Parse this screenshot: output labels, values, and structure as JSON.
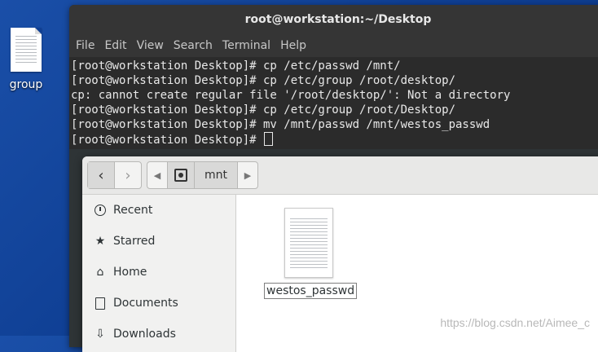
{
  "desktop": {
    "icon_label": "group",
    "icon": "text-file-icon"
  },
  "terminal": {
    "title": "root@workstation:~/Desktop",
    "menu": [
      "File",
      "Edit",
      "View",
      "Search",
      "Terminal",
      "Help"
    ],
    "lines": [
      "[root@workstation Desktop]# cp /etc/passwd /mnt/",
      "[root@workstation Desktop]# cp /etc/group /root/desktop/",
      "cp: cannot create regular file '/root/desktop/': Not a directory",
      "[root@workstation Desktop]# cp /etc/group /root/Desktop/",
      "[root@workstation Desktop]# mv /mnt/passwd /mnt/westos_passwd",
      "[root@workstation Desktop]# "
    ]
  },
  "files": {
    "nav": {
      "back": "‹",
      "forward": "›"
    },
    "path": {
      "current": "mnt"
    },
    "sidebar": [
      {
        "label": "Recent",
        "icon": "clock-icon"
      },
      {
        "label": "Starred",
        "icon": "star-icon"
      },
      {
        "label": "Home",
        "icon": "home-icon"
      },
      {
        "label": "Documents",
        "icon": "document-icon"
      },
      {
        "label": "Downloads",
        "icon": "download-icon"
      }
    ],
    "items": [
      {
        "name": "westos_passwd",
        "icon": "text-file-icon"
      }
    ]
  },
  "watermark": "https://blog.csdn.net/Aimee_c"
}
